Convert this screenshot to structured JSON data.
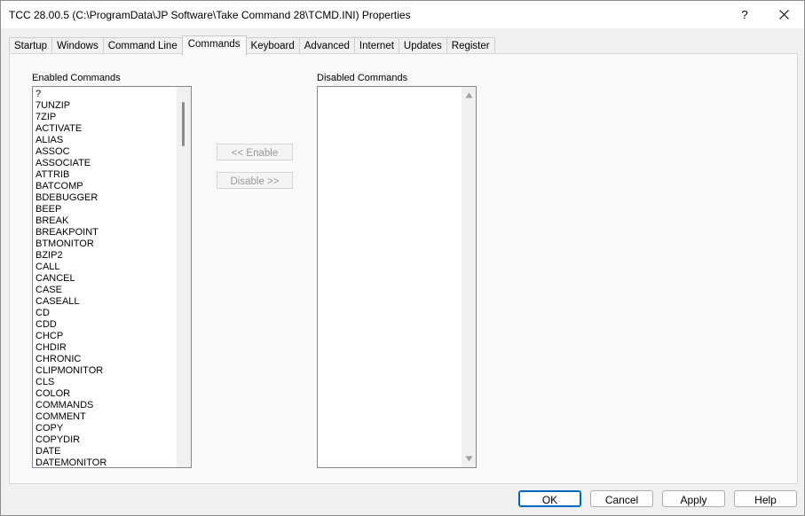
{
  "window": {
    "title": "TCC  28.00.5  (C:\\ProgramData\\JP Software\\Take Command 28\\TCMD.INI)  Properties",
    "help_glyph": "?",
    "close_glyph": "✕"
  },
  "tabs": [
    {
      "label": "Startup"
    },
    {
      "label": "Windows"
    },
    {
      "label": "Command Line"
    },
    {
      "label": "Commands",
      "active": true
    },
    {
      "label": "Keyboard"
    },
    {
      "label": "Advanced"
    },
    {
      "label": "Internet"
    },
    {
      "label": "Updates"
    },
    {
      "label": "Register"
    }
  ],
  "commands_tab": {
    "enabled_label": "Enabled Commands",
    "disabled_label": "Disabled Commands",
    "enable_button": "<< Enable",
    "disable_button": "Disable >>",
    "enabled_commands": [
      "?",
      "7UNZIP",
      "7ZIP",
      "ACTIVATE",
      "ALIAS",
      "ASSOC",
      "ASSOCIATE",
      "ATTRIB",
      "BATCOMP",
      "BDEBUGGER",
      "BEEP",
      "BREAK",
      "BREAKPOINT",
      "BTMONITOR",
      "BZIP2",
      "CALL",
      "CANCEL",
      "CASE",
      "CASEALL",
      "CD",
      "CDD",
      "CHCP",
      "CHDIR",
      "CHRONIC",
      "CLIPMONITOR",
      "CLS",
      "COLOR",
      "COMMANDS",
      "COMMENT",
      "COPY",
      "COPYDIR",
      "DATE",
      "DATEMONITOR"
    ],
    "disabled_commands": []
  },
  "footer": {
    "ok": "OK",
    "cancel": "Cancel",
    "apply": "Apply",
    "help": "Help"
  }
}
